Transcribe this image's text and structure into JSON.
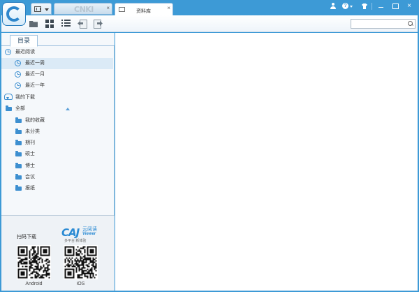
{
  "window": {
    "tabs": [
      {
        "label": "CNKI",
        "close": "×"
      },
      {
        "label": "资料库",
        "close": "×"
      }
    ],
    "controls": {
      "close": "×"
    }
  },
  "toolbar": {
    "search_placeholder": ""
  },
  "sidebar": {
    "tab_label": "目录",
    "recent": {
      "label": "最近阅读",
      "items": [
        "最近一周",
        "最近一月",
        "最近一年"
      ]
    },
    "downloads_label": "我的下载",
    "all": {
      "label": "全部",
      "items": [
        "我的收藏",
        "未分类",
        "期刊",
        "硕士",
        "博士",
        "会议",
        "报纸"
      ]
    }
  },
  "qr_panel": {
    "scan_label": "扫码下载",
    "brand": "CAJ",
    "brand_sub": "云阅读",
    "brand_viewer": "Viewer",
    "tagline": "多平台 新体验",
    "android_label": "Android",
    "ios_label": "iOS"
  },
  "colors": {
    "frame": "#3d9ad6",
    "accent": "#3d8fd0",
    "selected_row": "#dbeaf6"
  }
}
